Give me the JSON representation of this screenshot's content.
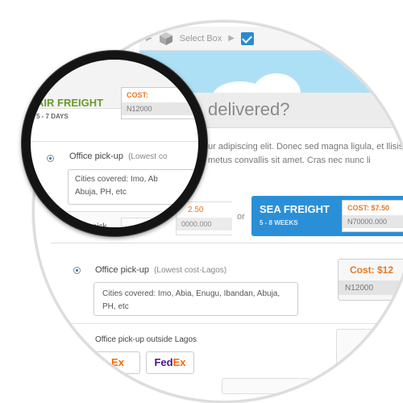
{
  "breadcrumb": {
    "select_box": "Select Box"
  },
  "heading": {
    "text": "delivered?"
  },
  "description": {
    "text": "ur adipiscing elit. Donec sed magna ligula, et llisis metus convallis sit amet. Cras nec nunc li"
  },
  "separator_or": "or",
  "air_freight": {
    "title": "AIR FREIGHT",
    "duration": "5 - 7 DAYS",
    "cost_label": "COST:",
    "cost_value": "N12000",
    "partial_cost_label": "2.50",
    "partial_cost_value": "0000.000"
  },
  "sea_freight": {
    "title": "SEA FREIGHT",
    "duration": "5 - 8 WEEKS",
    "cost_label": "COST: $7.50",
    "cost_value": "N70000.000"
  },
  "options": {
    "office_pickup": {
      "label": "Office pick-up",
      "sub": "(Lowest cost-Lagos)",
      "sub_partial": "(Lowest co",
      "cities": "Cities covered: Imo, Abia, Enugu, Ibandan, Abuja, PH, etc",
      "cities_partial_1": "Cities covered: Imo, Ab",
      "cities_partial_2": "Abuja, PH, etc",
      "pickup_partial": "Office pick",
      "cost_label": "Cost: $12",
      "cost_value": "N12000"
    },
    "outside_lagos": {
      "label": "Office pick-up outside Lagos"
    }
  },
  "couriers": {
    "fedex_1": {
      "a": "",
      "b": "Ex"
    },
    "fedex_2": {
      "a": "Fed",
      "b": "Ex"
    }
  },
  "colors": {
    "accent_blue": "#2b8fd8",
    "cost_orange": "#e87722",
    "air_green": "#6a9a2a",
    "sky": "#aee0f5"
  }
}
